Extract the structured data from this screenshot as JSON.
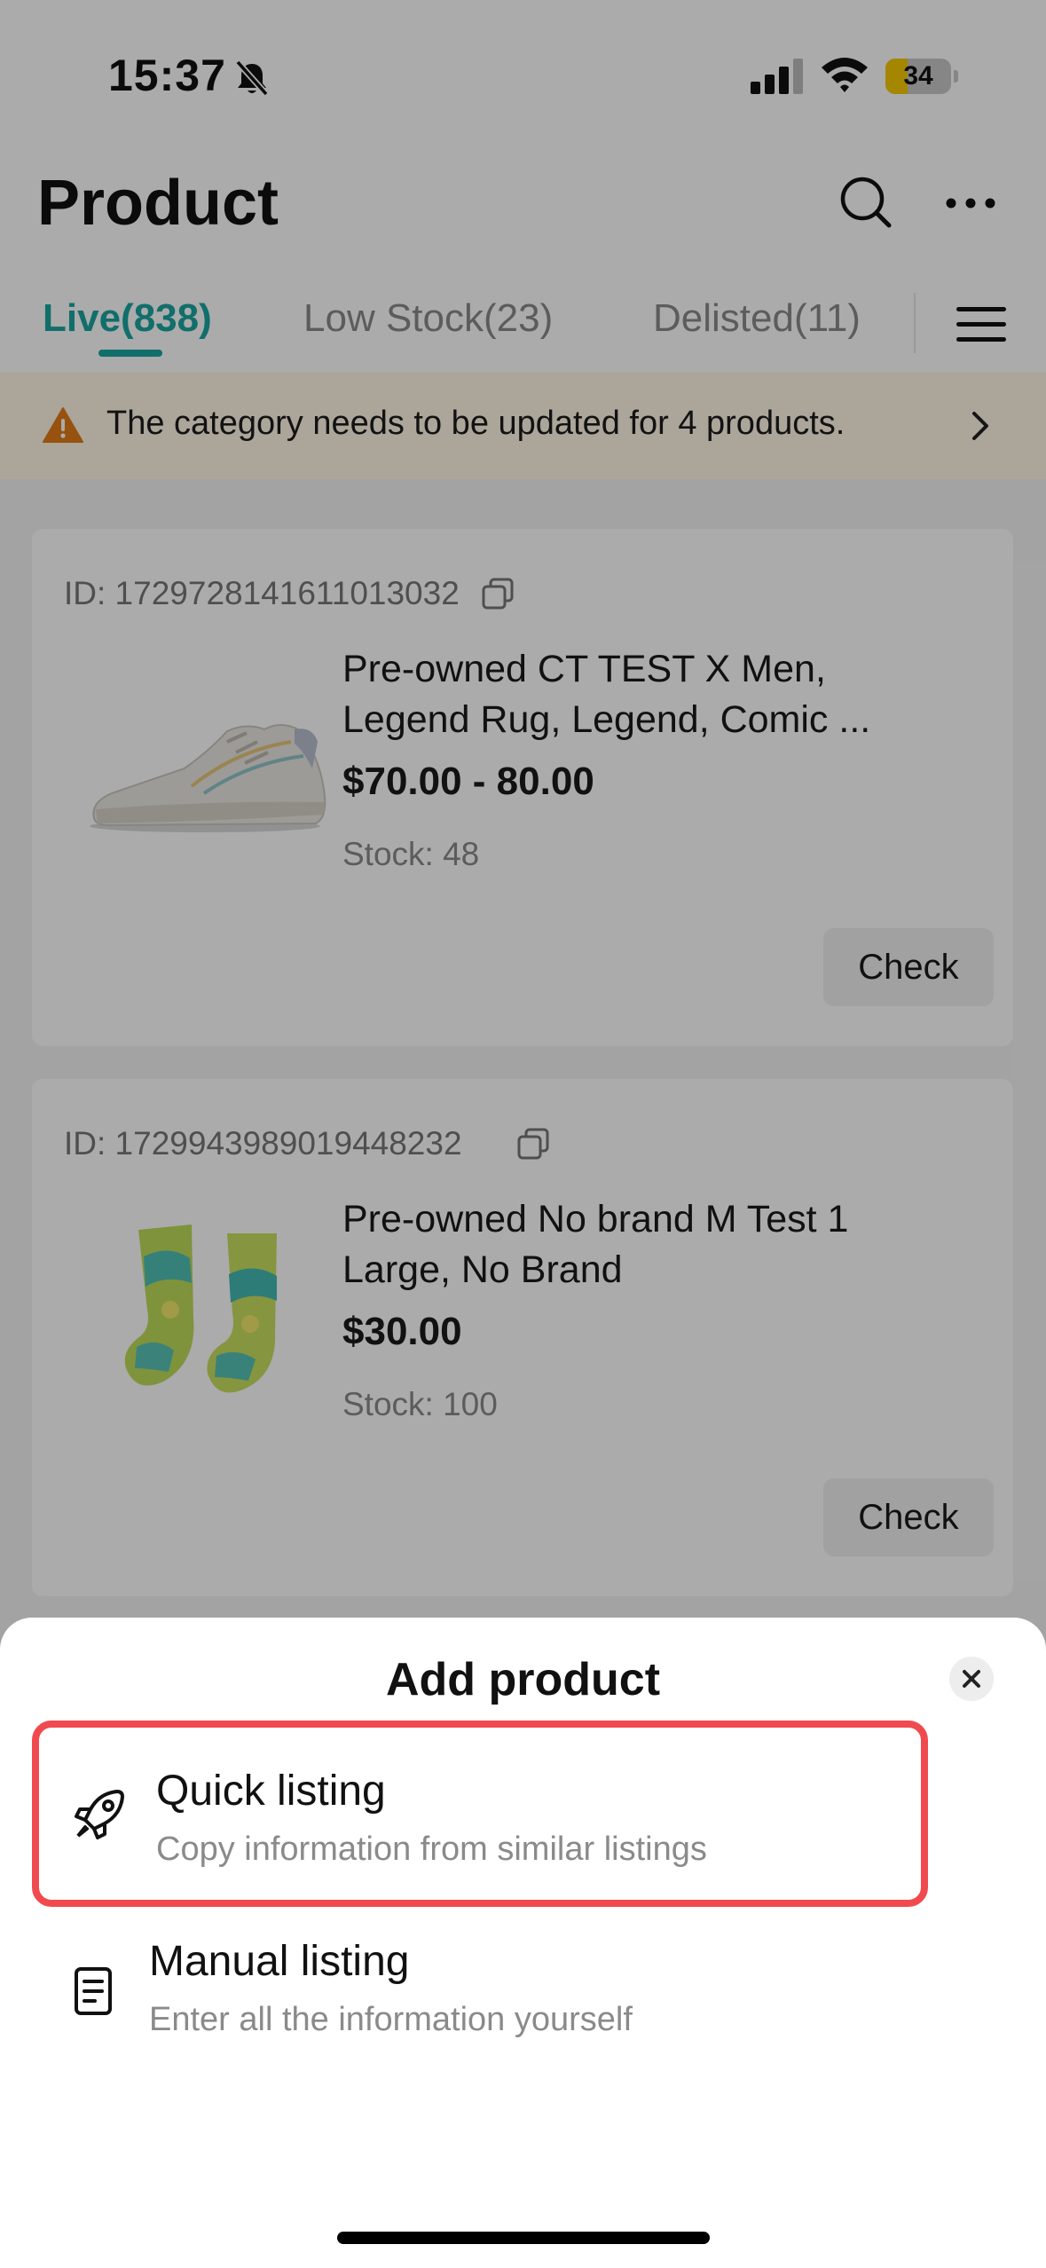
{
  "status_bar": {
    "time": "15:37",
    "battery": "34",
    "battery_level": 0.34
  },
  "header": {
    "title": "Product",
    "tabs": [
      {
        "label": "Live(838)",
        "active": true
      },
      {
        "label": "Low Stock(23)",
        "active": false
      },
      {
        "label": "Delisted(11)",
        "active": false
      }
    ]
  },
  "banner": {
    "text": "The category needs to be updated for 4 products."
  },
  "products": [
    {
      "id": "ID: 1729728141611013032",
      "title_line1": "Pre-owned CT TEST X Men,",
      "title_line2": "Legend Rug, Legend, Comic ...",
      "price": "$70.00 - 80.00",
      "stock": "Stock: 48",
      "action": "Check"
    },
    {
      "id": "ID: 1729943989019448232",
      "title_line1": "Pre-owned No brand M Test 1",
      "title_line2": "Large, No Brand",
      "price": "$30.00",
      "stock": "Stock: 100",
      "action": "Check"
    }
  ],
  "sheet": {
    "title": "Add product",
    "options": [
      {
        "title": "Quick listing",
        "subtitle": "Copy information from similar listings",
        "icon": "rocket-icon"
      },
      {
        "title": "Manual listing",
        "subtitle": "Enter all the information yourself",
        "icon": "document-icon"
      }
    ]
  },
  "colors": {
    "accent": "#1aa5a0",
    "highlight": "#f04a4f",
    "banner_bg": "#fff6e6",
    "warning": "#e07b16"
  }
}
